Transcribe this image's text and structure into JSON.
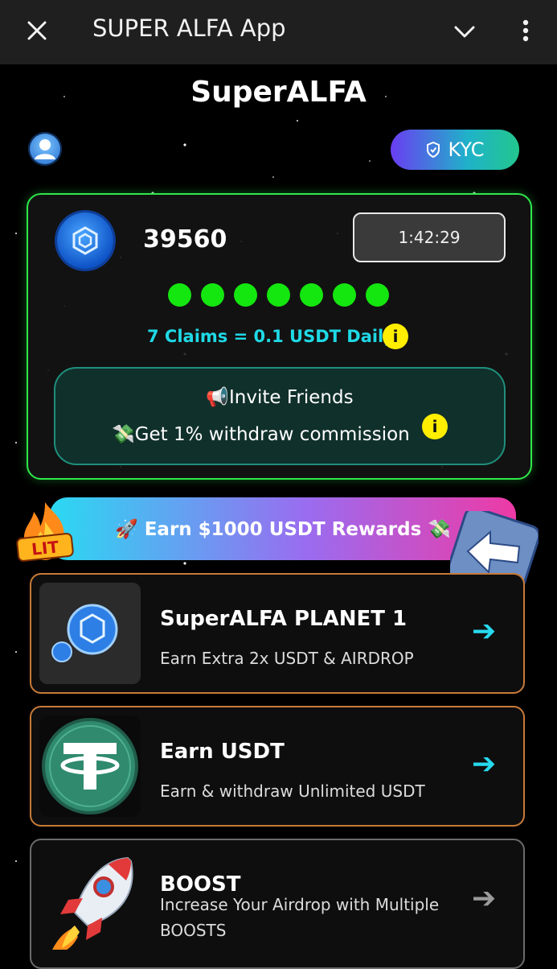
{
  "topbar": {
    "close_icon": "close-icon",
    "title": "SUPER ALFA App",
    "chevron_icon": "chevron-down-icon",
    "more_icon": "more-vertical-icon"
  },
  "header": {
    "app_title": "SuperALFA",
    "kyc_label": "KYC"
  },
  "mining": {
    "points": "39560",
    "timer": "1:42:29",
    "claims_done": 7,
    "claims_text": "7 Claims = 0.1 USDT Daily",
    "info_glyph": "i",
    "invite_title": "📢Invite Friends",
    "invite_sub": "💸Get 1% withdraw commission"
  },
  "banner": {
    "label": "🚀 Earn $1000 USDT Rewards 💸"
  },
  "badges": {
    "lit_text": "LIT"
  },
  "tasks": [
    {
      "title": "SuperALFA PLANET 1",
      "subtitle": "Earn Extra 2x USDT & AIRDROP",
      "arrow": "➔"
    },
    {
      "title": "Earn USDT",
      "subtitle": "Earn & withdraw Unlimited USDT",
      "arrow": "➔"
    },
    {
      "title": "BOOST",
      "subtitle": "Increase Your Airdrop with Multiple BOOSTS",
      "arrow": "➔"
    }
  ],
  "colors": {
    "accent_green": "#2ee84a",
    "accent_cyan": "#1fd9e6",
    "task_border_orange": "#c77a38"
  }
}
